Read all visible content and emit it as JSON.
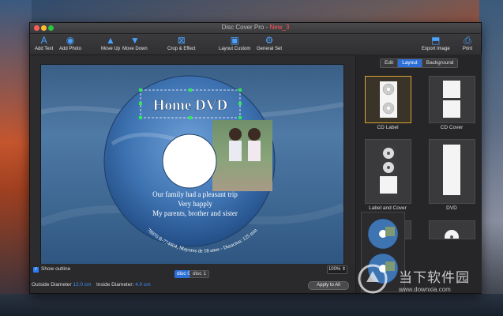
{
  "window": {
    "title": "Disc Cover Pro - ",
    "title_flag": "New_3"
  },
  "toolbar": {
    "add_text": "Add Text",
    "add_photo": "Add Photo",
    "move_up": "Move Up",
    "move_down": "Move Down",
    "crop_effect": "Crop & Effect",
    "layout_custom": "Layout Custom",
    "general_set": "General Set",
    "export_image": "Export Image",
    "print": "Print"
  },
  "disc": {
    "title": "Home DVD",
    "lines": [
      "Our family had a pleasant trip",
      "Very happly",
      "My parents, brother and sister"
    ],
    "arc_text": "78970 B-774404, Mayores de 18 anos - Duracion: 125 min"
  },
  "bottom": {
    "show_outline": "Show outline",
    "zoom": "100%",
    "disc_a": "disc 0",
    "disc_b": "disc 1",
    "outside_label": "Outside Diameter",
    "outside_value": "12.0 cm",
    "inside_label": "Inside Diameter:",
    "inside_value": "4.0 cm",
    "apply": "Apply to All"
  },
  "sidebar": {
    "tabs": [
      "Edit",
      "Layout",
      "Background"
    ],
    "active_tab": "Layout",
    "layouts": [
      "CD Label",
      "CD Cover",
      "Label and Cover",
      "DVD"
    ]
  },
  "watermark": {
    "text": "当下软件园",
    "url": "www.downxia.com"
  },
  "colors": {
    "accent": "#2d6fd8",
    "selection": "#d9a233",
    "disc_blue": "#3f74b3"
  }
}
